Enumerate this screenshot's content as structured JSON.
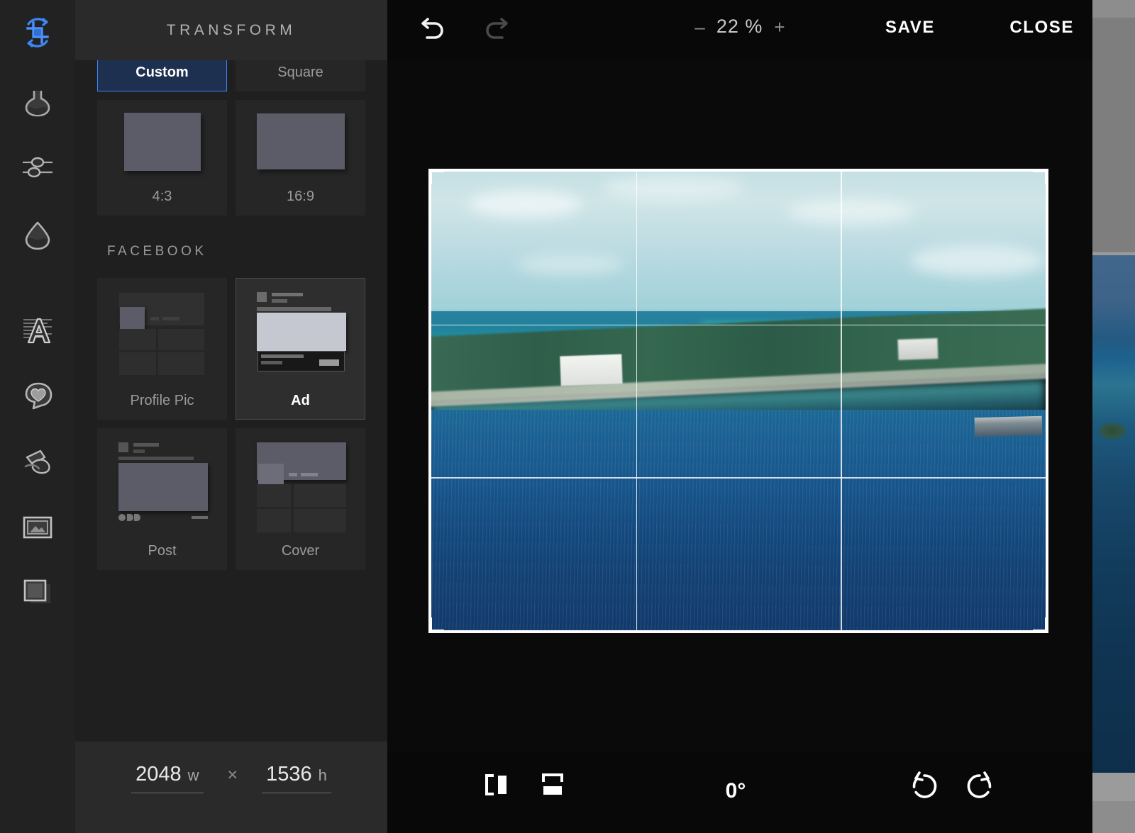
{
  "app": {
    "panel_title": "TRANSFORM"
  },
  "toolrail": {
    "items": [
      {
        "name": "crop-transform-icon",
        "label": "Transform",
        "active": true
      },
      {
        "name": "effects-flask-icon",
        "label": "Effects",
        "active": false
      },
      {
        "name": "adjustments-sliders-icon",
        "label": "Adjust",
        "active": false
      },
      {
        "name": "color-drop-icon",
        "label": "Color",
        "active": false
      },
      {
        "name": "text-icon",
        "label": "Text",
        "active": false
      },
      {
        "name": "sticker-heart-icon",
        "label": "Stickers",
        "active": false
      },
      {
        "name": "brush-icon",
        "label": "Brush",
        "active": false
      },
      {
        "name": "frame-icon",
        "label": "Frame",
        "active": false
      },
      {
        "name": "overlay-square-icon",
        "label": "Overlay",
        "active": false
      }
    ]
  },
  "topbar": {
    "undo_icon": "undo-arrow-icon",
    "redo_icon": "redo-arrow-icon",
    "zoom_minus": "–",
    "zoom_value": "22 %",
    "zoom_plus": "+",
    "save_label": "SAVE",
    "close_label": "CLOSE"
  },
  "presets": {
    "ratio_tiles": [
      {
        "label": "Custom",
        "thumb": "custom-dashed-thumb",
        "selected": true
      },
      {
        "label": "Square",
        "thumb": "square-thumb",
        "selected": false
      },
      {
        "label": "4:3",
        "thumb": "ratio-4-3-thumb",
        "selected": false
      },
      {
        "label": "16:9",
        "thumb": "ratio-16-9-thumb",
        "selected": false
      }
    ],
    "facebook_section_title": "FACEBOOK",
    "facebook_tiles": [
      {
        "label": "Profile Pic",
        "thumb": "fb-profile-pic-thumb",
        "selected": false
      },
      {
        "label": "Ad",
        "thumb": "fb-ad-thumb",
        "selected": true
      },
      {
        "label": "Post",
        "thumb": "fb-post-thumb",
        "selected": false
      },
      {
        "label": "Cover",
        "thumb": "fb-cover-thumb",
        "selected": false
      }
    ]
  },
  "dimensions": {
    "width_value": "2048",
    "width_unit": "w",
    "separator": "×",
    "height_value": "1536",
    "height_unit": "h"
  },
  "bottombar": {
    "flip_horizontal_icon": "flip-horizontal-icon",
    "flip_vertical_icon": "flip-vertical-icon",
    "angle_value": "0°",
    "rotate_ccw_icon": "rotate-counterclockwise-icon",
    "rotate_cw_icon": "rotate-clockwise-icon"
  },
  "canvas": {
    "image_description": "Aerial photo of a tropical island with turquoise sea",
    "crop_overlay": "rule-of-thirds-grid"
  },
  "colors": {
    "accent_blue": "#3d86f5",
    "panel_bg": "#1f1f1f",
    "panel_head_bg": "#2a2a2a",
    "rail_bg": "#222222",
    "canvas_bg": "#0a0a0a",
    "bar_bg": "#080808",
    "tile_bg": "#262626",
    "tile_selected_bg": "#1d3050",
    "text_muted": "#9b9b9b",
    "text_bright": "#ffffff"
  }
}
